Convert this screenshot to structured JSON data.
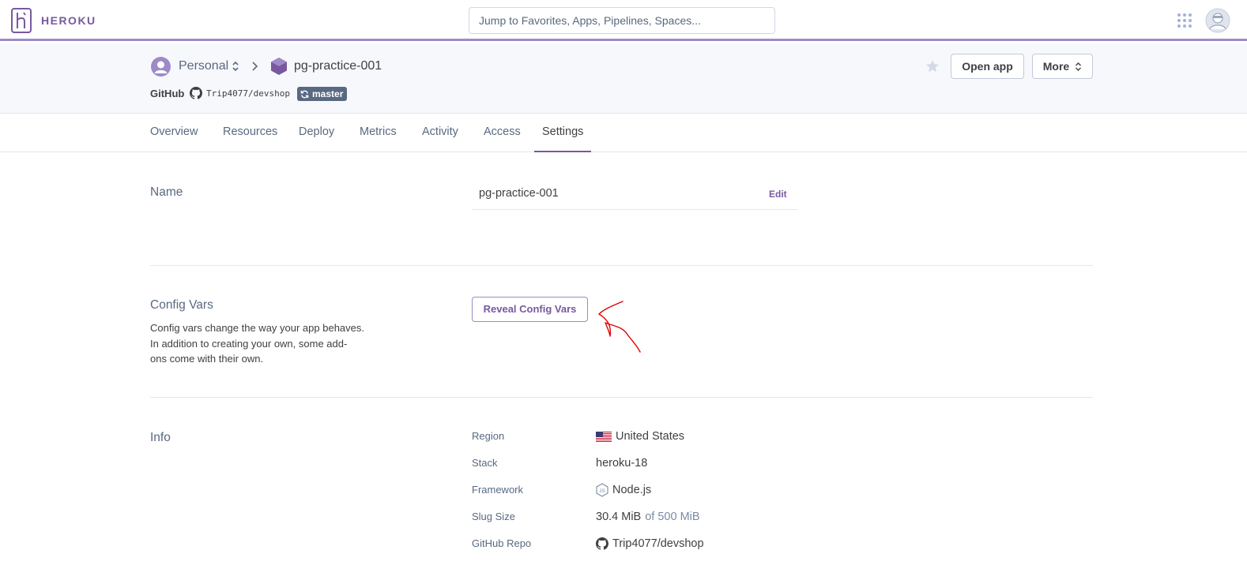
{
  "brand": {
    "name": "HEROKU",
    "accent": "#79589f"
  },
  "search": {
    "placeholder": "Jump to Favorites, Apps, Pipelines, Spaces..."
  },
  "header": {
    "account": "Personal",
    "app_name": "pg-practice-001",
    "source_label": "GitHub",
    "repo": "Trip4077/devshop",
    "branch": "master",
    "open_app_label": "Open app",
    "more_label": "More"
  },
  "tabs": [
    {
      "label": "Overview"
    },
    {
      "label": "Resources"
    },
    {
      "label": "Deploy"
    },
    {
      "label": "Metrics"
    },
    {
      "label": "Activity"
    },
    {
      "label": "Access"
    },
    {
      "label": "Settings",
      "active": true
    }
  ],
  "sections": {
    "name": {
      "title": "Name",
      "value": "pg-practice-001",
      "edit_label": "Edit"
    },
    "config_vars": {
      "title": "Config Vars",
      "description_lines": [
        "Config vars change the way your app behaves.",
        "In addition to creating your own, some add-",
        "ons come with their own."
      ],
      "button_label": "Reveal Config Vars"
    },
    "info": {
      "title": "Info",
      "rows": [
        {
          "label": "Region",
          "value": "United States",
          "icon": "us-flag-icon"
        },
        {
          "label": "Stack",
          "value": "heroku-18"
        },
        {
          "label": "Framework",
          "value": "Node.js",
          "icon": "nodejs-icon"
        },
        {
          "label": "Slug Size",
          "value": "30.4 MiB",
          "suffix": "of 500 MiB"
        },
        {
          "label": "GitHub Repo",
          "value": "Trip4077/devshop",
          "icon": "github-icon"
        }
      ]
    }
  },
  "annotation_color": "#e00000"
}
